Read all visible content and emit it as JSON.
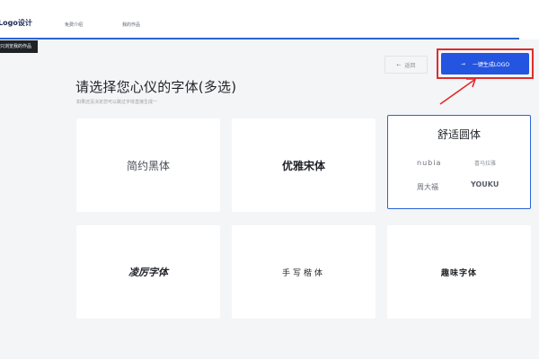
{
  "header": {
    "logo_title": "Logo设计",
    "badge": "只浏览我的作品",
    "nav": [
      "免费介绍",
      "我的作品"
    ]
  },
  "actions": {
    "back_label": "返回",
    "back_arrow": "←",
    "generate_label": "一键生成LOGO",
    "generate_arrow": "→"
  },
  "main": {
    "title": "请选择您心仪的字体(多选)",
    "subtitle": "如果还没决定您可以跳过字体直接生成一"
  },
  "fonts": {
    "card1": "简约黑体",
    "card2": "优雅宋体",
    "card3_title": "舒适圆体",
    "card3_brands": [
      "nubia",
      "喜马拉雅",
      "周大福",
      "YOUKU"
    ],
    "card4": "凌厉字体",
    "card5": "手写楷体",
    "card6": "趣味字体"
  },
  "colors": {
    "accent": "#2455e0",
    "highlight_box": "#e02c2c"
  }
}
